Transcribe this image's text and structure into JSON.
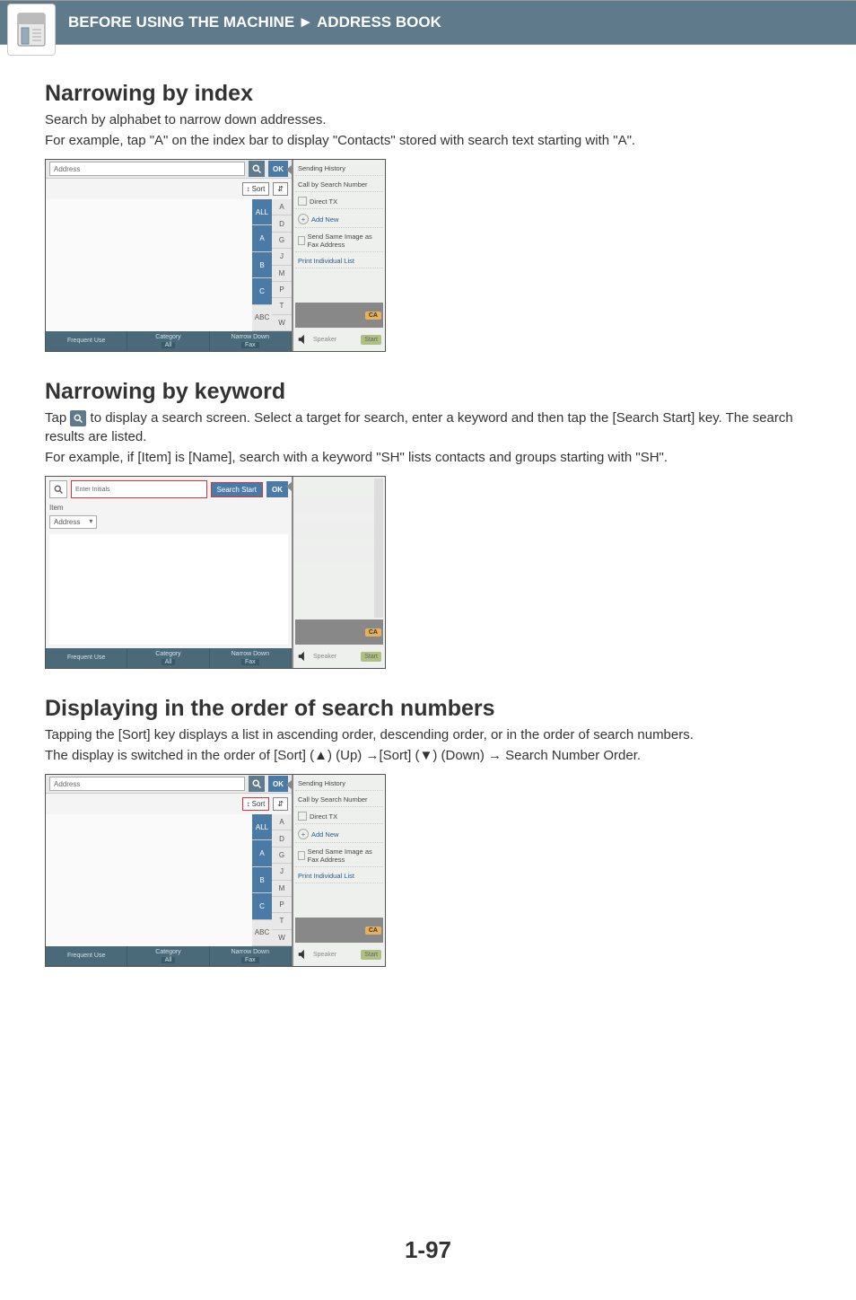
{
  "header": {
    "breadcrumb1": "BEFORE USING THE MACHINE",
    "breadcrumb2": "ADDRESS BOOK"
  },
  "sections": {
    "s1": {
      "title": "Narrowing by index",
      "p1": "Search by alphabet to narrow down addresses.",
      "p2": "For example, tap \"A\" on the index bar to display \"Contacts\" stored with search text starting with \"A\"."
    },
    "s2": {
      "title": "Narrowing by keyword",
      "p1a": "Tap ",
      "p1b": " to display a search screen. Select a target for search, enter a keyword and then tap the [Search Start] key. The search results are listed.",
      "p2": "For example, if [Item] is [Name], search with a keyword \"SH\" lists contacts and groups starting with \"SH\"."
    },
    "s3": {
      "title": "Displaying in the order of search numbers",
      "p1": "Tapping the [Sort] key displays a list in ascending order, descending order, or in the order of search numbers.",
      "p2": "The display is switched in the order of [Sort] (▲) (Up) →[Sort] (▼) (Down) → Search Number Order."
    }
  },
  "mock": {
    "address_label": "Address",
    "ok": "OK",
    "sort": "Sort",
    "frequent_use": "Frequent Use",
    "category": "Category",
    "all": "All",
    "narrow_down": "Narrow Down",
    "fax": "Fax",
    "abc": "ABC",
    "index": {
      "all": "ALL",
      "a": "A",
      "b": "B",
      "c": "C",
      "d": "D",
      "g": "G",
      "j": "J",
      "m": "M",
      "p": "P",
      "t": "T",
      "w": "W"
    },
    "side": {
      "sending_history": "Sending History",
      "call_by_search_number": "Call by Search Number",
      "direct_tx": "Direct TX",
      "add_new": "Add New",
      "send_same_image": "Send Same Image as Fax Address",
      "print_individual_list": "Print Individual List",
      "ca": "CA",
      "speaker": "Speaker",
      "start": "Start"
    },
    "search": {
      "enter_initials": "Enter Initials",
      "search_start": "Search Start",
      "item": "Item",
      "address": "Address"
    }
  },
  "page_number": "1-97"
}
